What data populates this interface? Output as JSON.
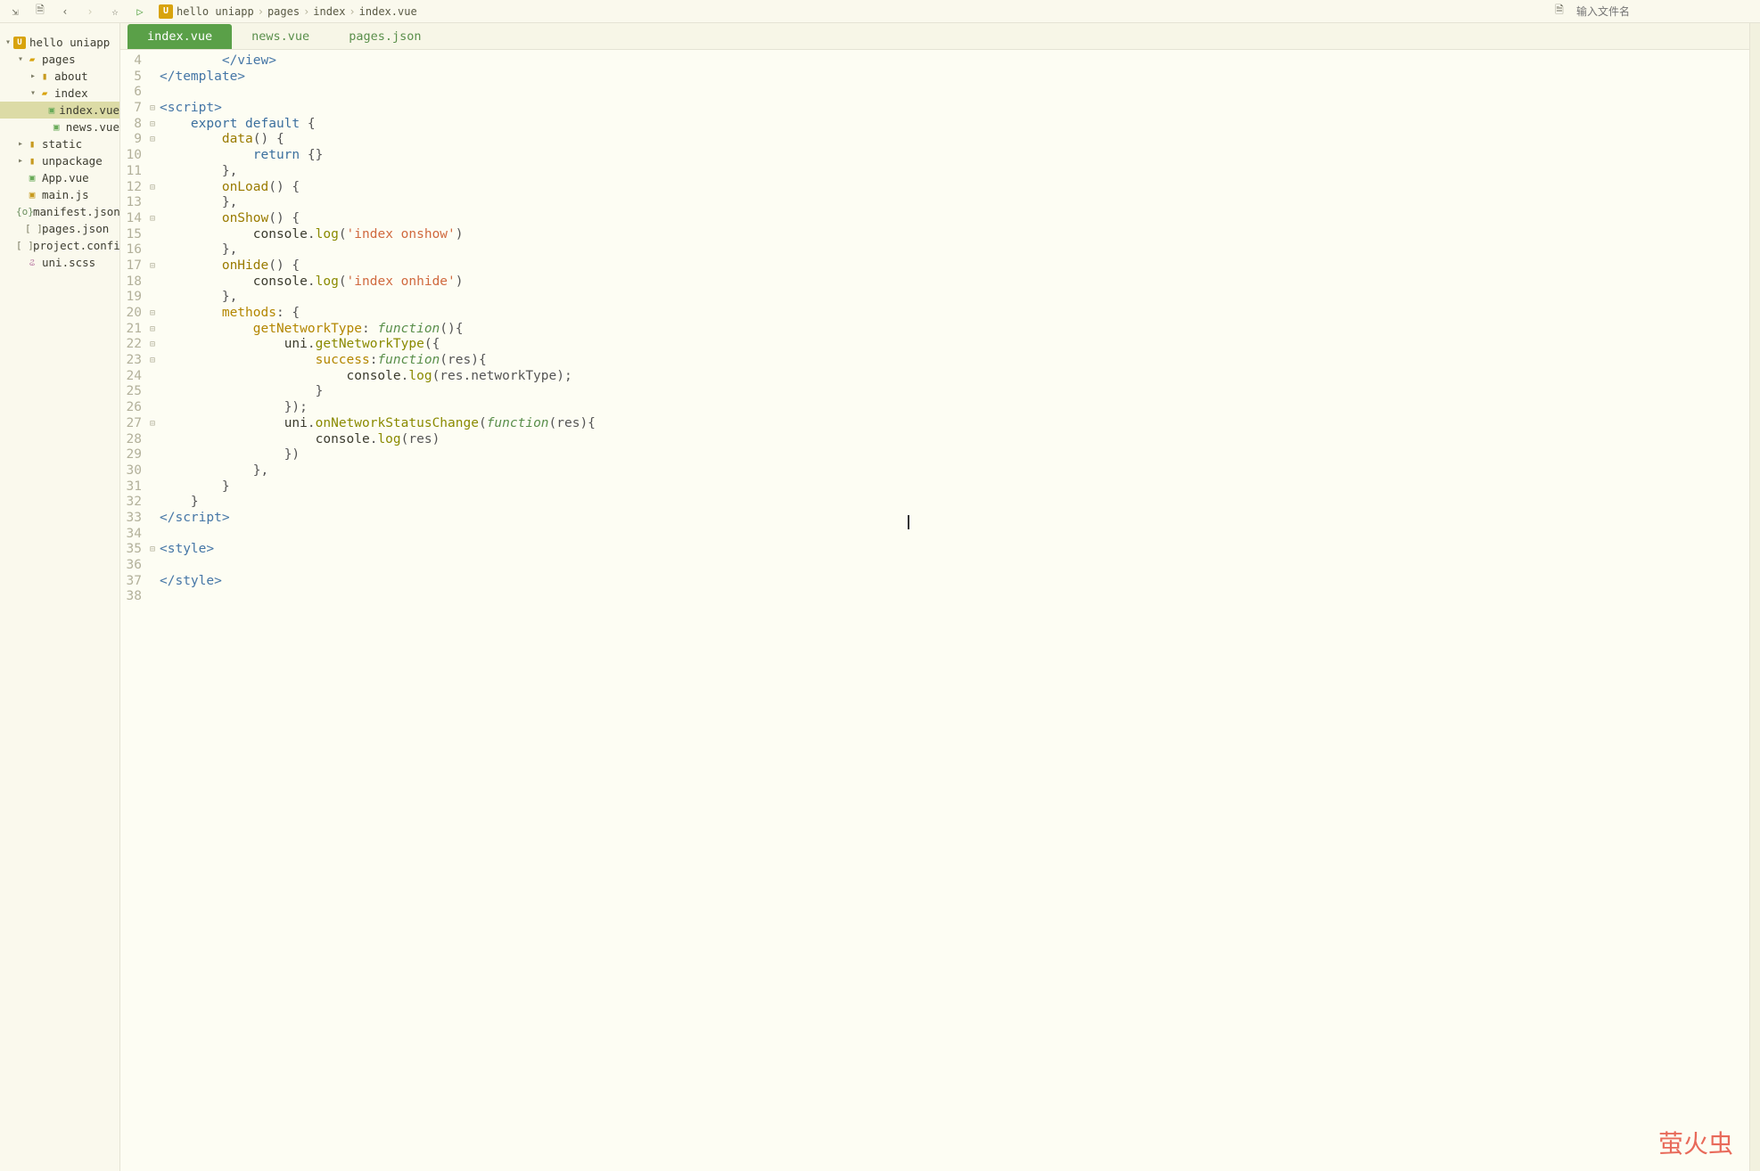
{
  "toolbar": {
    "search_placeholder": "输入文件名"
  },
  "breadcrumb": [
    "hello uniapp",
    "pages",
    "index",
    "index.vue"
  ],
  "tabs": [
    {
      "label": "index.vue",
      "active": true
    },
    {
      "label": "news.vue",
      "active": false
    },
    {
      "label": "pages.json",
      "active": false
    }
  ],
  "tree": [
    {
      "depth": 0,
      "twist": "▾",
      "icon": "app",
      "label": "hello uniapp",
      "sel": false
    },
    {
      "depth": 1,
      "twist": "▾",
      "icon": "fold-open",
      "label": "pages",
      "sel": false
    },
    {
      "depth": 2,
      "twist": "▸",
      "icon": "fold",
      "label": "about",
      "sel": false
    },
    {
      "depth": 2,
      "twist": "▾",
      "icon": "fold-open",
      "label": "index",
      "sel": false
    },
    {
      "depth": 3,
      "twist": "",
      "icon": "vue",
      "label": "index.vue",
      "sel": true
    },
    {
      "depth": 3,
      "twist": "",
      "icon": "vue",
      "label": "news.vue",
      "sel": false
    },
    {
      "depth": 1,
      "twist": "▸",
      "icon": "fold",
      "label": "static",
      "sel": false
    },
    {
      "depth": 1,
      "twist": "▸",
      "icon": "fold",
      "label": "unpackage",
      "sel": false
    },
    {
      "depth": 1,
      "twist": "",
      "icon": "vue",
      "label": "App.vue",
      "sel": false
    },
    {
      "depth": 1,
      "twist": "",
      "icon": "js",
      "label": "main.js",
      "sel": false
    },
    {
      "depth": 1,
      "twist": "",
      "icon": "json",
      "label": "manifest.json",
      "sel": false
    },
    {
      "depth": 1,
      "twist": "",
      "icon": "brackets",
      "label": "pages.json",
      "sel": false
    },
    {
      "depth": 1,
      "twist": "",
      "icon": "brackets",
      "label": "project.config....",
      "sel": false
    },
    {
      "depth": 1,
      "twist": "",
      "icon": "scss",
      "label": "uni.scss",
      "sel": false
    }
  ],
  "code": {
    "first_line": 4,
    "lines": [
      {
        "n": 4,
        "f": "",
        "h": "        <span class='t-tag'>&lt;/view&gt;</span>"
      },
      {
        "n": 5,
        "f": "",
        "h": "<span class='t-tag'>&lt;/template&gt;</span>"
      },
      {
        "n": 6,
        "f": "",
        "h": ""
      },
      {
        "n": 7,
        "f": "⊟",
        "h": "<span class='t-tag'>&lt;script&gt;</span>"
      },
      {
        "n": 8,
        "f": "⊟",
        "h": "    <span class='t-kw'>export</span> <span class='t-kw'>default</span> <span class='t-punc'>{</span>"
      },
      {
        "n": 9,
        "f": "⊟",
        "h": "        <span class='t-fn'>data</span><span class='t-punc'>() {</span>"
      },
      {
        "n": 10,
        "f": "",
        "h": "            <span class='t-kw'>return</span> <span class='t-punc'>{}</span>"
      },
      {
        "n": 11,
        "f": "",
        "h": "        <span class='t-punc'>},</span>"
      },
      {
        "n": 12,
        "f": "⊟",
        "h": "        <span class='t-fn'>onLoad</span><span class='t-punc'>() {</span>"
      },
      {
        "n": 13,
        "f": "",
        "h": "        <span class='t-punc'>},</span>"
      },
      {
        "n": 14,
        "f": "⊟",
        "h": "        <span class='t-fn'>onShow</span><span class='t-punc'>() {</span>"
      },
      {
        "n": 15,
        "f": "",
        "h": "            <span class='t-plain'>console</span><span class='t-punc'>.</span><span class='t-call'>log</span><span class='t-punc'>(</span><span class='t-str'>'index onshow'</span><span class='t-punc'>)</span>"
      },
      {
        "n": 16,
        "f": "",
        "h": "        <span class='t-punc'>},</span>"
      },
      {
        "n": 17,
        "f": "⊟",
        "h": "        <span class='t-fn'>onHide</span><span class='t-punc'>() {</span>"
      },
      {
        "n": 18,
        "f": "",
        "h": "            <span class='t-plain'>console</span><span class='t-punc'>.</span><span class='t-call'>log</span><span class='t-punc'>(</span><span class='t-str'>'index onhide'</span><span class='t-punc'>)</span>"
      },
      {
        "n": 19,
        "f": "",
        "h": "        <span class='t-punc'>},</span>"
      },
      {
        "n": 20,
        "f": "⊟",
        "h": "        <span class='t-attr'>methods</span><span class='t-punc'>: {</span>"
      },
      {
        "n": 21,
        "f": "⊟",
        "h": "            <span class='t-attr'>getNetworkType</span><span class='t-punc'>:</span> <span class='t-kw2'>function</span><span class='t-punc'>(){</span>"
      },
      {
        "n": 22,
        "f": "⊟",
        "h": "                <span class='t-plain'>uni</span><span class='t-punc'>.</span><span class='t-call'>getNetworkType</span><span class='t-punc'>({</span>"
      },
      {
        "n": 23,
        "f": "⊟",
        "h": "                    <span class='t-attr'>success</span><span class='t-punc'>:</span><span class='t-kw2'>function</span><span class='t-punc'>(res){</span>"
      },
      {
        "n": 24,
        "f": "",
        "h": "                        <span class='t-plain'>console</span><span class='t-punc'>.</span><span class='t-call'>log</span><span class='t-punc'>(res.networkType);</span>"
      },
      {
        "n": 25,
        "f": "",
        "h": "                    <span class='t-punc'>}</span>"
      },
      {
        "n": 26,
        "f": "",
        "h": "                <span class='t-punc'>});</span>"
      },
      {
        "n": 27,
        "f": "⊟",
        "h": "                <span class='t-plain'>uni</span><span class='t-punc'>.</span><span class='t-call'>onNetworkStatusChange</span><span class='t-punc'>(</span><span class='t-kw2'>function</span><span class='t-punc'>(res){</span>"
      },
      {
        "n": 28,
        "f": "",
        "h": "                    <span class='t-plain'>console</span><span class='t-punc'>.</span><span class='t-call'>log</span><span class='t-punc'>(res)</span>"
      },
      {
        "n": 29,
        "f": "",
        "h": "                <span class='t-punc'>})</span>"
      },
      {
        "n": 30,
        "f": "",
        "h": "            <span class='t-punc'>},</span>"
      },
      {
        "n": 31,
        "f": "",
        "h": "        <span class='t-punc'>}</span>"
      },
      {
        "n": 32,
        "f": "",
        "h": "    <span class='t-punc'>}</span>"
      },
      {
        "n": 33,
        "f": "",
        "h": "<span class='t-tag'>&lt;/script&gt;</span>"
      },
      {
        "n": 34,
        "f": "",
        "h": ""
      },
      {
        "n": 35,
        "f": "⊟",
        "h": "<span class='t-tag'>&lt;style&gt;</span>"
      },
      {
        "n": 36,
        "f": "",
        "h": ""
      },
      {
        "n": 37,
        "f": "",
        "h": "<span class='t-tag'>&lt;/style&gt;</span>"
      },
      {
        "n": 38,
        "f": "",
        "h": ""
      }
    ]
  },
  "watermark": "萤火虫"
}
